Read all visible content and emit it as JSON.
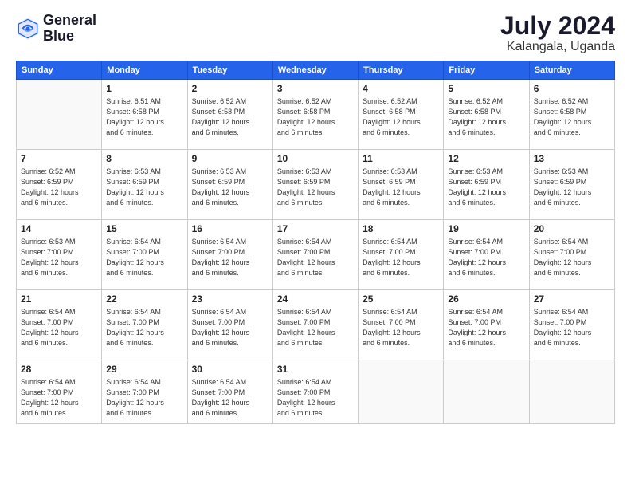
{
  "header": {
    "logo_line1": "General",
    "logo_line2": "Blue",
    "month_year": "July 2024",
    "location": "Kalangala, Uganda"
  },
  "columns": [
    "Sunday",
    "Monday",
    "Tuesday",
    "Wednesday",
    "Thursday",
    "Friday",
    "Saturday"
  ],
  "weeks": [
    [
      {
        "day": "",
        "info": ""
      },
      {
        "day": "1",
        "info": "Sunrise: 6:51 AM\nSunset: 6:58 PM\nDaylight: 12 hours\nand 6 minutes."
      },
      {
        "day": "2",
        "info": "Sunrise: 6:52 AM\nSunset: 6:58 PM\nDaylight: 12 hours\nand 6 minutes."
      },
      {
        "day": "3",
        "info": "Sunrise: 6:52 AM\nSunset: 6:58 PM\nDaylight: 12 hours\nand 6 minutes."
      },
      {
        "day": "4",
        "info": "Sunrise: 6:52 AM\nSunset: 6:58 PM\nDaylight: 12 hours\nand 6 minutes."
      },
      {
        "day": "5",
        "info": "Sunrise: 6:52 AM\nSunset: 6:58 PM\nDaylight: 12 hours\nand 6 minutes."
      },
      {
        "day": "6",
        "info": "Sunrise: 6:52 AM\nSunset: 6:58 PM\nDaylight: 12 hours\nand 6 minutes."
      }
    ],
    [
      {
        "day": "7",
        "info": "Sunrise: 6:52 AM\nSunset: 6:59 PM\nDaylight: 12 hours\nand 6 minutes."
      },
      {
        "day": "8",
        "info": "Sunrise: 6:53 AM\nSunset: 6:59 PM\nDaylight: 12 hours\nand 6 minutes."
      },
      {
        "day": "9",
        "info": "Sunrise: 6:53 AM\nSunset: 6:59 PM\nDaylight: 12 hours\nand 6 minutes."
      },
      {
        "day": "10",
        "info": "Sunrise: 6:53 AM\nSunset: 6:59 PM\nDaylight: 12 hours\nand 6 minutes."
      },
      {
        "day": "11",
        "info": "Sunrise: 6:53 AM\nSunset: 6:59 PM\nDaylight: 12 hours\nand 6 minutes."
      },
      {
        "day": "12",
        "info": "Sunrise: 6:53 AM\nSunset: 6:59 PM\nDaylight: 12 hours\nand 6 minutes."
      },
      {
        "day": "13",
        "info": "Sunrise: 6:53 AM\nSunset: 6:59 PM\nDaylight: 12 hours\nand 6 minutes."
      }
    ],
    [
      {
        "day": "14",
        "info": "Sunrise: 6:53 AM\nSunset: 7:00 PM\nDaylight: 12 hours\nand 6 minutes."
      },
      {
        "day": "15",
        "info": "Sunrise: 6:54 AM\nSunset: 7:00 PM\nDaylight: 12 hours\nand 6 minutes."
      },
      {
        "day": "16",
        "info": "Sunrise: 6:54 AM\nSunset: 7:00 PM\nDaylight: 12 hours\nand 6 minutes."
      },
      {
        "day": "17",
        "info": "Sunrise: 6:54 AM\nSunset: 7:00 PM\nDaylight: 12 hours\nand 6 minutes."
      },
      {
        "day": "18",
        "info": "Sunrise: 6:54 AM\nSunset: 7:00 PM\nDaylight: 12 hours\nand 6 minutes."
      },
      {
        "day": "19",
        "info": "Sunrise: 6:54 AM\nSunset: 7:00 PM\nDaylight: 12 hours\nand 6 minutes."
      },
      {
        "day": "20",
        "info": "Sunrise: 6:54 AM\nSunset: 7:00 PM\nDaylight: 12 hours\nand 6 minutes."
      }
    ],
    [
      {
        "day": "21",
        "info": "Sunrise: 6:54 AM\nSunset: 7:00 PM\nDaylight: 12 hours\nand 6 minutes."
      },
      {
        "day": "22",
        "info": "Sunrise: 6:54 AM\nSunset: 7:00 PM\nDaylight: 12 hours\nand 6 minutes."
      },
      {
        "day": "23",
        "info": "Sunrise: 6:54 AM\nSunset: 7:00 PM\nDaylight: 12 hours\nand 6 minutes."
      },
      {
        "day": "24",
        "info": "Sunrise: 6:54 AM\nSunset: 7:00 PM\nDaylight: 12 hours\nand 6 minutes."
      },
      {
        "day": "25",
        "info": "Sunrise: 6:54 AM\nSunset: 7:00 PM\nDaylight: 12 hours\nand 6 minutes."
      },
      {
        "day": "26",
        "info": "Sunrise: 6:54 AM\nSunset: 7:00 PM\nDaylight: 12 hours\nand 6 minutes."
      },
      {
        "day": "27",
        "info": "Sunrise: 6:54 AM\nSunset: 7:00 PM\nDaylight: 12 hours\nand 6 minutes."
      }
    ],
    [
      {
        "day": "28",
        "info": "Sunrise: 6:54 AM\nSunset: 7:00 PM\nDaylight: 12 hours\nand 6 minutes."
      },
      {
        "day": "29",
        "info": "Sunrise: 6:54 AM\nSunset: 7:00 PM\nDaylight: 12 hours\nand 6 minutes."
      },
      {
        "day": "30",
        "info": "Sunrise: 6:54 AM\nSunset: 7:00 PM\nDaylight: 12 hours\nand 6 minutes."
      },
      {
        "day": "31",
        "info": "Sunrise: 6:54 AM\nSunset: 7:00 PM\nDaylight: 12 hours\nand 6 minutes."
      },
      {
        "day": "",
        "info": ""
      },
      {
        "day": "",
        "info": ""
      },
      {
        "day": "",
        "info": ""
      }
    ]
  ]
}
